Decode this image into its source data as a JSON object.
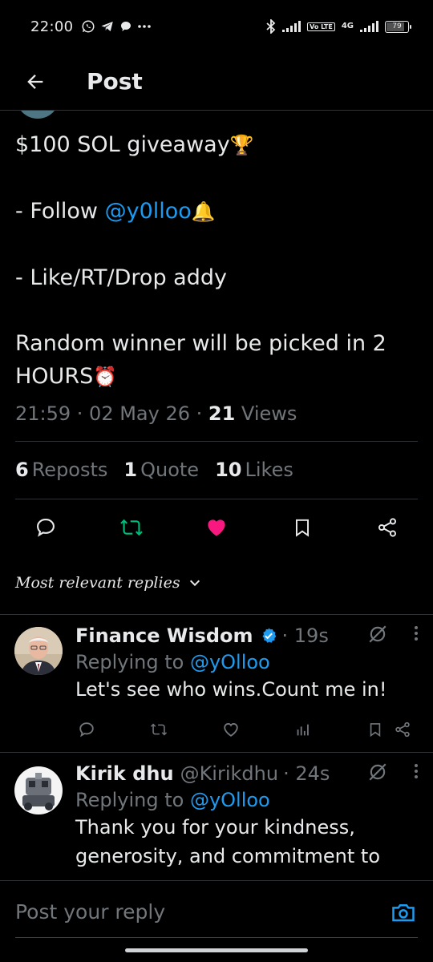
{
  "status_bar": {
    "time": "22:00",
    "network_label": "4G",
    "volte_label": "Vo LTE",
    "battery_level": "79"
  },
  "header": {
    "title": "Post"
  },
  "post": {
    "lines": {
      "l1_text": "$100 SOL giveaway",
      "l1_emoji": "🏆",
      "l2_prefix": "- Follow ",
      "l2_mention": "@y0lloo",
      "l2_emoji": "🔔",
      "l3_text": "- Like/RT/Drop addy",
      "l4_text": "Random winner will be picked in 2",
      "l5_text": "HOURS",
      "l5_emoji": "⏰"
    },
    "timestamp": "21:59 · 02 May 26 · ",
    "views_count": "21",
    "views_label": " Views"
  },
  "stats": {
    "reposts_count": "6",
    "reposts_label": "Reposts",
    "quotes_count": "1",
    "quotes_label": "Quote",
    "likes_count": "10",
    "likes_label": "Likes"
  },
  "actions": {
    "reply_icon": "comment-icon",
    "repost_icon": "repost-icon",
    "like_icon": "heart-icon",
    "bookmark_icon": "bookmark-icon",
    "share_icon": "share-icon",
    "repost_color": "#00ba7c",
    "like_color": "#f91880"
  },
  "sort": {
    "label": "Most relevant replies"
  },
  "replies": [
    {
      "name": "Finance Wisdom",
      "handle": "",
      "time": "· 19s",
      "replying_prefix": "Replying to ",
      "replying_mention": "@yOlloo",
      "text": "Let's see who wins.Count me in!"
    },
    {
      "name": "Kirik dhu",
      "handle": "@Kirikdhu",
      "time": "· 24s",
      "replying_prefix": "Replying to ",
      "replying_mention": "@yOlloo",
      "text_line1": "Thank you for your kindness,",
      "text_line2": "generosity, and commitment to"
    }
  ],
  "composer": {
    "placeholder": "Post your reply"
  },
  "colors": {
    "background": "#000000",
    "text": "#e7e9ea",
    "muted": "#71767b",
    "accent": "#1d9bf0",
    "divider": "#2f3336"
  }
}
